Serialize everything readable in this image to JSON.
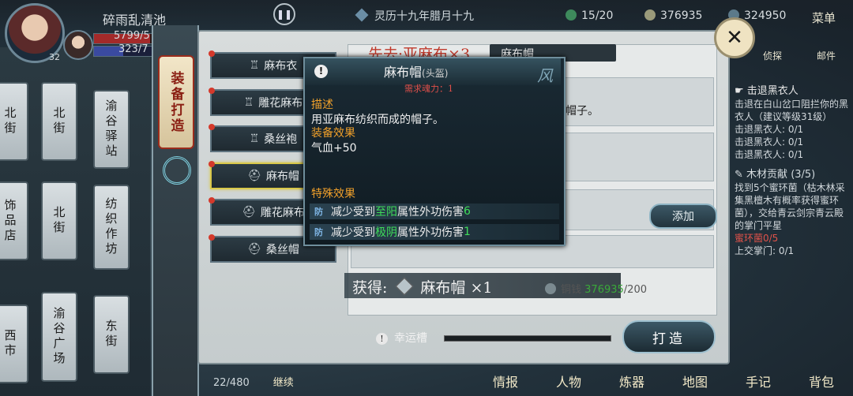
{
  "hud": {
    "player_name": "碎雨乱清池",
    "hp": "5799/5",
    "mp": "323/7",
    "level": "32",
    "date": "灵历十九年腊月十九",
    "energy": "15/20",
    "currency1": "376935",
    "currency2": "324950",
    "menu": "菜单"
  },
  "map": {
    "nodes": [
      "北街",
      "北街",
      "渝谷驿站",
      "饰品店",
      "北街",
      "纺织作坊",
      "西市",
      "渝谷广场",
      "东街"
    ]
  },
  "panel": {
    "banner": "装备打造",
    "header_title": "先去·亚麻布×3",
    "header_sub": "麻布帽",
    "desc_fragment": "帽子。",
    "add_button": "添加",
    "gain_label": "获得:",
    "gain_item": "麻布帽 ×1",
    "cost_label": "铜钱",
    "cost_have": "376935",
    "cost_need": "/200",
    "luck_label": "幸运槽",
    "forge_button": "打造"
  },
  "items": [
    {
      "label": "麻布衣",
      "icon": "robe-icon"
    },
    {
      "label": "雕花麻布",
      "icon": "robe-icon"
    },
    {
      "label": "桑丝袍",
      "icon": "robe-icon"
    },
    {
      "label": "麻布帽",
      "icon": "hat-icon"
    },
    {
      "label": "雕花麻布",
      "icon": "hat-icon"
    },
    {
      "label": "桑丝帽",
      "icon": "hat-icon"
    }
  ],
  "tooltip": {
    "name": "麻布帽",
    "type": "(头盔)",
    "requirement": "需求魂力：1",
    "wind_glyph": "风",
    "desc_title": "描述",
    "desc_text": "用亚麻布纺织而成的帽子。",
    "equip_title": "装备效果",
    "equip_text": "气血+50",
    "special_title": "特殊效果",
    "effects": [
      {
        "prefix": "减少受到",
        "element": "至阳",
        "suffix": "属性外功伤害",
        "value": "6"
      },
      {
        "prefix": "减少受到",
        "element": "极阴",
        "suffix": "属性外功伤害",
        "value": "1"
      }
    ],
    "shield_label": "防"
  },
  "quests": {
    "q1_title": "击退黑衣人",
    "q1_desc": "击退在白山岔口阻拦你的黑衣人（建议等级31级）",
    "q1_line1": "击退黑衣人: 0/1",
    "q1_line2": "击退黑衣人: 0/1",
    "q1_line3": "击退黑衣人: 0/1",
    "q2_title": "木材贡献",
    "q2_count": "(3/5)",
    "q2_desc": "找到5个蜜环菌（枯木林采集黑檀木有概率获得蜜环菌），交给青云剑宗青云殿的掌门平星",
    "q2_line1": "蜜环菌0/5",
    "q2_line2": "上交掌门: 0/1"
  },
  "top_icons": [
    "侦探",
    "邮件"
  ],
  "bottom_nav": [
    "情报",
    "人物",
    "炼器",
    "地图",
    "手记",
    "背包"
  ],
  "bottom_left": {
    "bag": "22/480",
    "go": "继续"
  }
}
